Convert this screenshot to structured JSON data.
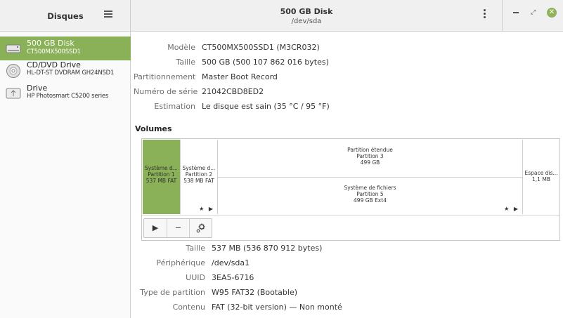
{
  "sidebar_header": {
    "title": "Disques"
  },
  "disk_header": {
    "title": "500 GB Disk",
    "subtitle": "/dev/sda"
  },
  "window_controls": {
    "maximize_glyph": "⤢",
    "close_glyph": "✕"
  },
  "sidebar": {
    "items": [
      {
        "name": "500 GB Disk",
        "desc": "CT500MX500SSD1",
        "icon": "hard-disk-icon",
        "selected": true
      },
      {
        "name": "CD/DVD Drive",
        "desc": "HL-DT-ST DVDRAM GH24NSD1",
        "icon": "optical-disc-icon",
        "selected": false
      },
      {
        "name": "Drive",
        "desc": "HP Photosmart C5200 series",
        "icon": "usb-drive-icon",
        "selected": false
      }
    ]
  },
  "disk_info": {
    "model_label": "Modèle",
    "model_value": "CT500MX500SSD1 (M3CR032)",
    "size_label": "Taille",
    "size_value": "500 GB (500 107 862 016 bytes)",
    "partitioning_label": "Partitionnement",
    "partitioning_value": "Master Boot Record",
    "serial_label": "Numéro de série",
    "serial_value": "21042CBD8ED2",
    "assessment_label": "Estimation",
    "assessment_value": "Le disque est sain (35 °C / 95 °F)"
  },
  "volumes": {
    "title": "Volumes",
    "p1": {
      "l1": "Système d...",
      "l2": "Partition 1",
      "l3": "537 MB FAT"
    },
    "p2": {
      "l1": "Système d...",
      "l2": "Partition 2",
      "l3": "538 MB FAT"
    },
    "ext": {
      "l1": "Partition étendue",
      "l2": "Partition 3",
      "l3": "499 GB"
    },
    "p5": {
      "l1": "Système de fichiers",
      "l2": "Partition 5",
      "l3": "499 GB Ext4"
    },
    "free": {
      "l1": "Espace dis...",
      "l2": "1,1 MB"
    },
    "flags": "★ ▶",
    "toolbar": {
      "play": "▶",
      "minus": "−"
    }
  },
  "partition_info": {
    "size_label": "Taille",
    "size_value": "537 MB (536 870 912 bytes)",
    "device_label": "Périphérique",
    "device_value": "/dev/sda1",
    "uuid_label": "UUID",
    "uuid_value": "3EA5-6716",
    "type_label": "Type de partition",
    "type_value": "W95 FAT32 (Bootable)",
    "content_label": "Contenu",
    "content_value": "FAT (32-bit version) — Non monté"
  },
  "colors": {
    "accent": "#8ab158",
    "close_button": "#8fb35a"
  }
}
